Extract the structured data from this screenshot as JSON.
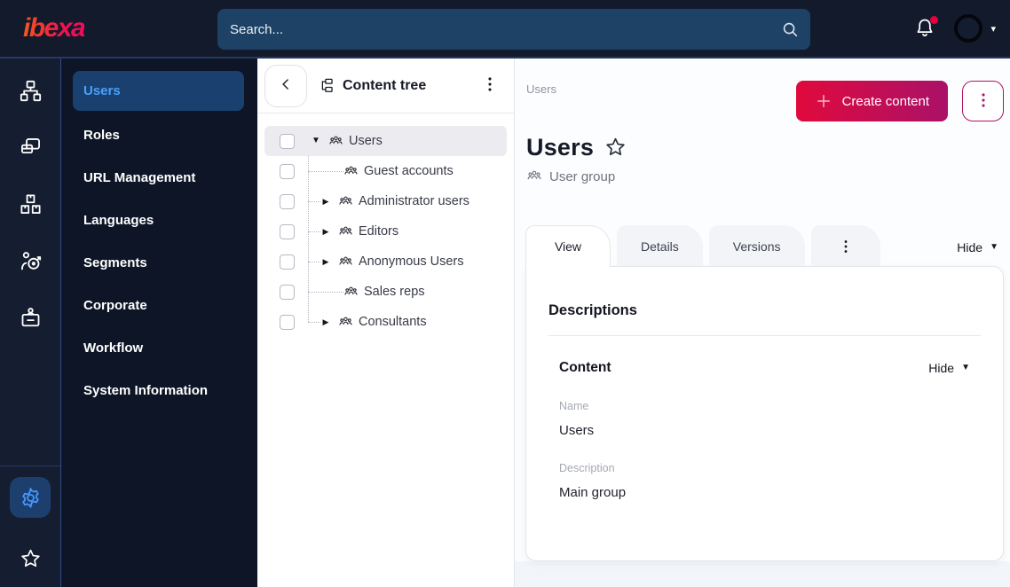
{
  "topbar": {
    "brand": "ibexa",
    "search_placeholder": "Search..."
  },
  "rail": {
    "top": [
      {
        "name": "content-structure-icon",
        "icon": "sitemap"
      },
      {
        "name": "pages-icon",
        "icon": "pages"
      },
      {
        "name": "products-icon",
        "icon": "boxes"
      },
      {
        "name": "personalization-icon",
        "icon": "target-person"
      },
      {
        "name": "corporate-badge-icon",
        "icon": "id-badge"
      }
    ],
    "bottom": [
      {
        "name": "settings-icon",
        "icon": "gear",
        "active": true
      },
      {
        "name": "bookmarks-icon",
        "icon": "star"
      }
    ]
  },
  "sidebar": {
    "items": [
      {
        "label": "Users",
        "active": true
      },
      {
        "label": "Roles"
      },
      {
        "label": "URL Management"
      },
      {
        "label": "Languages"
      },
      {
        "label": "Segments"
      },
      {
        "label": "Corporate"
      },
      {
        "label": "Workflow"
      },
      {
        "label": "System Information"
      }
    ]
  },
  "content_tree": {
    "title": "Content tree",
    "items": [
      {
        "label": "Users",
        "level": 0,
        "expanded": true,
        "selected": true,
        "has_children": true
      },
      {
        "label": "Guest accounts",
        "level": 1,
        "has_children": false
      },
      {
        "label": "Administrator users",
        "level": 1,
        "has_children": true
      },
      {
        "label": "Editors",
        "level": 1,
        "has_children": true
      },
      {
        "label": "Anonymous Users",
        "level": 1,
        "has_children": true
      },
      {
        "label": "Sales reps",
        "level": 1,
        "has_children": false
      },
      {
        "label": "Consultants",
        "level": 1,
        "has_children": true
      }
    ]
  },
  "main": {
    "breadcrumb": "Users",
    "create_button_label": "Create content",
    "title": "Users",
    "content_type_label": "User group",
    "tabs": [
      {
        "label": "View",
        "active": true
      },
      {
        "label": "Details"
      },
      {
        "label": "Versions"
      },
      {
        "kebab": true
      }
    ],
    "hide_label": "Hide",
    "card": {
      "heading": "Descriptions",
      "section_title": "Content",
      "section_hide_label": "Hide",
      "fields": [
        {
          "label": "Name",
          "value": "Users"
        },
        {
          "label": "Description",
          "value": "Main group"
        }
      ]
    }
  },
  "icons": {
    "caret_down_glyph": "▼",
    "caret_right_glyph": "▶",
    "dropdown_caret_glyph": "▾"
  },
  "colors": {
    "topbar_bg": "#131a2c",
    "sidebar_bg": "#0d1526",
    "rail_bg": "#151d30",
    "accent_blue": "#4796ff",
    "active_item_bg": "#19406f",
    "search_bg": "#1e4265",
    "brand_gradient_start": "#f4581c",
    "brand_gradient_end": "#ee0f5e",
    "primary_gradient_start": "#e00a3d",
    "primary_gradient_end": "#aa1168",
    "notification_dot": "#e4003f",
    "tree_selected_bg": "#ecebf0"
  }
}
